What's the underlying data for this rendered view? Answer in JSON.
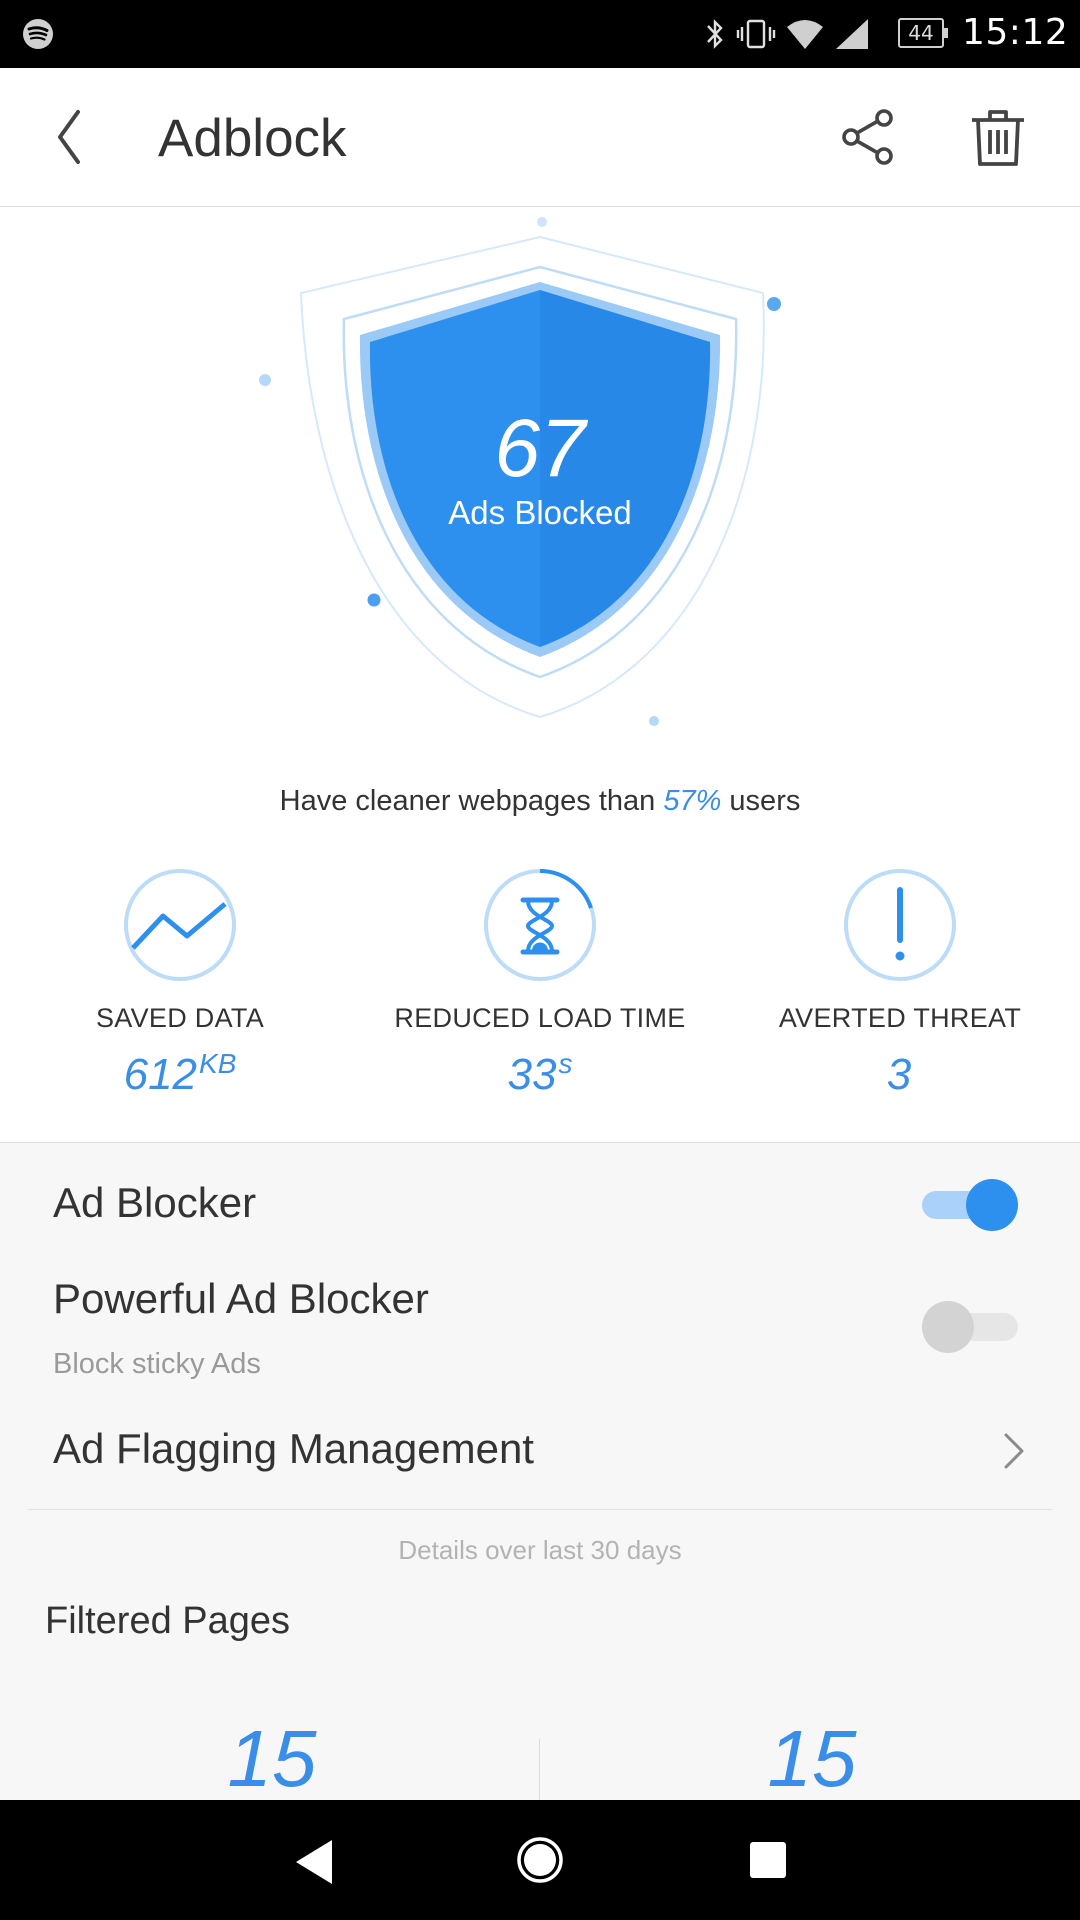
{
  "status_bar": {
    "time": "15:12",
    "battery": "44",
    "icons": [
      "spotify-icon",
      "bluetooth-icon",
      "vibrate-icon",
      "wifi-icon",
      "signal-icon",
      "battery-icon"
    ]
  },
  "app_bar": {
    "title": "Adblock",
    "actions": [
      "back-icon",
      "share-icon",
      "trash-icon"
    ]
  },
  "hero": {
    "count": "67",
    "count_label": "Ads Blocked",
    "comparison_prefix": "Have cleaner webpages than ",
    "comparison_value": "57%",
    "comparison_suffix": " users"
  },
  "stats": [
    {
      "label": "SAVED DATA",
      "value": "612",
      "unit": "KB",
      "icon": "trend-icon"
    },
    {
      "label": "REDUCED LOAD TIME",
      "value": "33",
      "unit": "s",
      "icon": "hourglass-icon"
    },
    {
      "label": "AVERTED THREAT",
      "value": "3",
      "unit": "",
      "icon": "exclamation-icon"
    }
  ],
  "settings": {
    "ad_blocker": {
      "label": "Ad Blocker",
      "enabled": true
    },
    "powerful_ad_blocker": {
      "label": "Powerful Ad Blocker",
      "sublabel": "Block sticky Ads",
      "enabled": false
    },
    "ad_flagging": {
      "label": "Ad Flagging Management"
    },
    "details_note": "Details over last 30 days",
    "filtered_pages": {
      "title": "Filtered Pages",
      "left_value": "15",
      "right_value": "15"
    }
  },
  "colors": {
    "accent": "#3a8ee8",
    "shield": "#2d8fee",
    "toggle_on": "#2d8fee"
  }
}
